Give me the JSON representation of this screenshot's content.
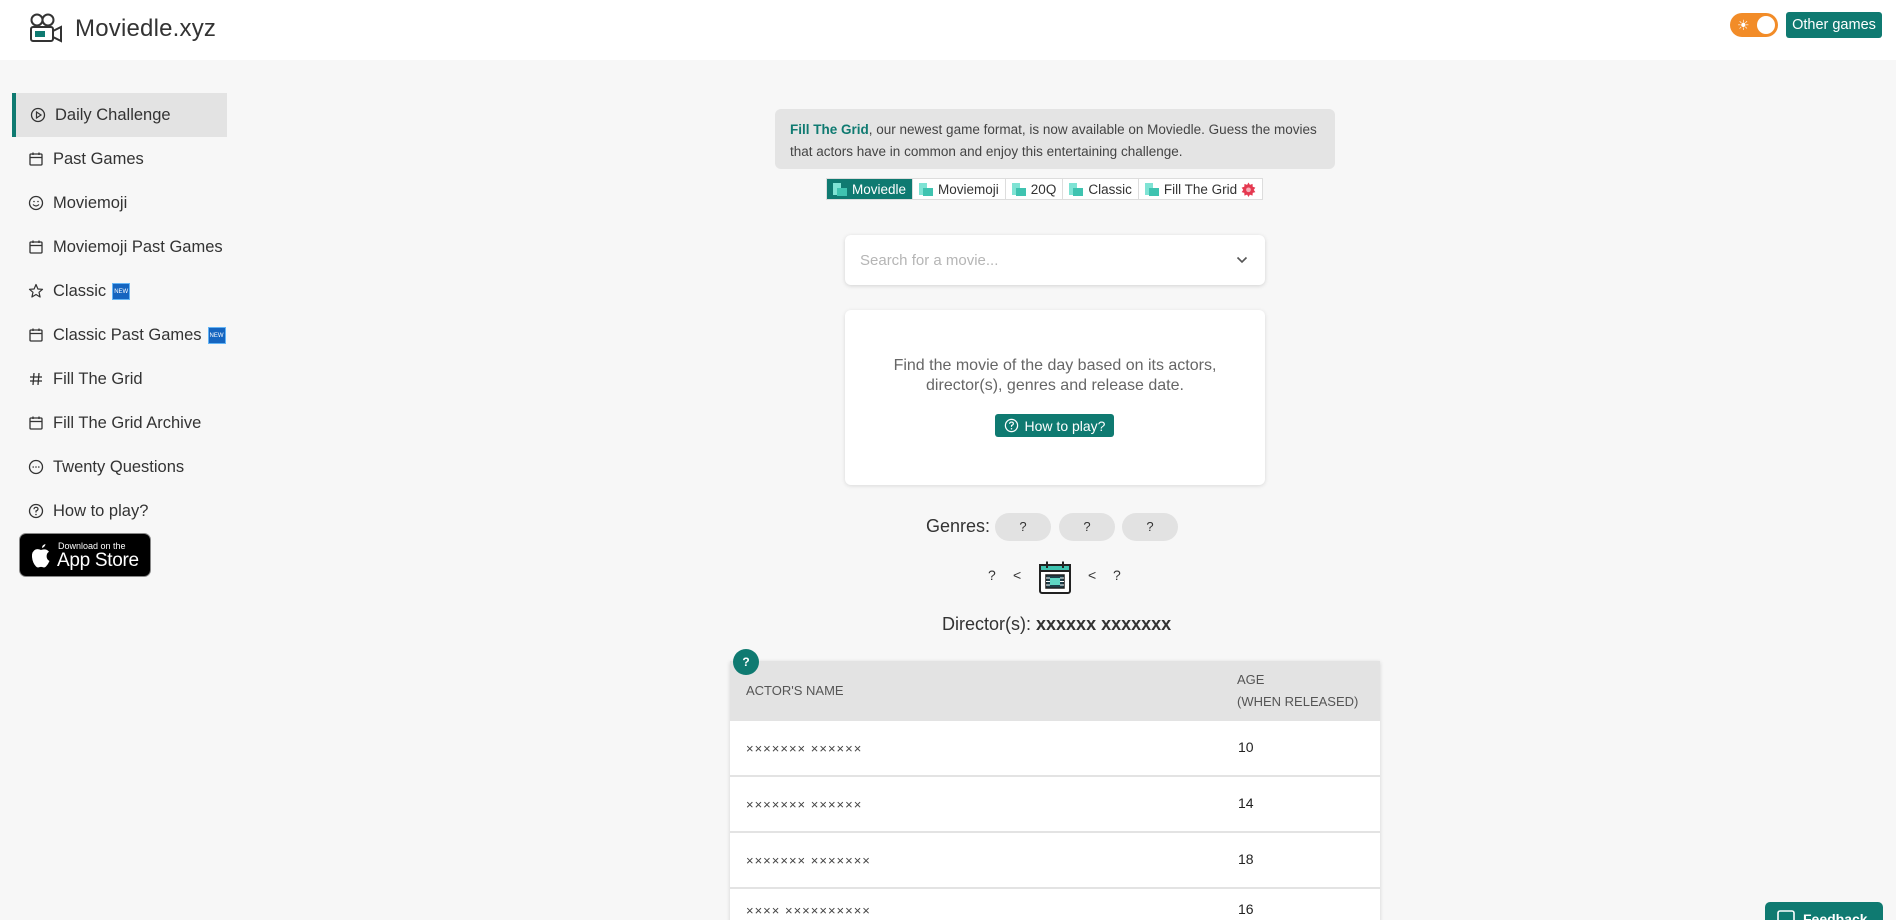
{
  "header": {
    "brand": "Moviedle.xyz",
    "other_games": "Other games"
  },
  "sidebar": {
    "items": [
      {
        "label": "Daily Challenge",
        "icon": "play-circle-icon",
        "active": true,
        "new": false
      },
      {
        "label": "Past Games",
        "icon": "calendar-icon",
        "new": false
      },
      {
        "label": "Moviemoji",
        "icon": "smiley-icon",
        "new": false
      },
      {
        "label": "Moviemoji Past Games",
        "icon": "calendar-icon",
        "new": false
      },
      {
        "label": "Classic",
        "icon": "star-icon",
        "new": true
      },
      {
        "label": "Classic Past Games",
        "icon": "calendar-icon",
        "new": true
      },
      {
        "label": "Fill The Grid",
        "icon": "hash-icon",
        "new": false
      },
      {
        "label": "Fill The Grid Archive",
        "icon": "calendar-icon",
        "new": false
      },
      {
        "label": "Twenty Questions",
        "icon": "chat-icon",
        "new": false
      },
      {
        "label": "How to play?",
        "icon": "help-circle-icon",
        "new": false
      }
    ],
    "new_badge": "NEW",
    "appstore_small": "Download on the",
    "appstore_big": "App Store"
  },
  "announcement": {
    "highlight": "Fill The Grid",
    "text": ", our newest game format, is now available on Moviedle. Guess the movies that actors have in common and enjoy this entertaining challenge."
  },
  "tabs": [
    "Moviedle",
    "Moviemoji",
    "20Q",
    "Classic",
    "Fill The Grid"
  ],
  "search": {
    "placeholder": "Search for a movie..."
  },
  "info": {
    "text": "Find the movie of the day based on its actors, director(s), genres and release date.",
    "button": "How to play?"
  },
  "genres": {
    "label": "Genres:",
    "values": [
      "?",
      "?",
      "?"
    ]
  },
  "year": {
    "min": "?",
    "lt1": "<",
    "lt2": "<",
    "max": "?"
  },
  "director": {
    "label": "Director(s):",
    "value": "xxxxxx xxxxxxx"
  },
  "table": {
    "help": "?",
    "col_name": "ACTOR'S NAME",
    "col_age": "AGE",
    "col_age_sub": "(WHEN RELEASED)",
    "rows": [
      {
        "name": "××××××× ××××××",
        "age": "10"
      },
      {
        "name": "××××××× ××××××",
        "age": "14"
      },
      {
        "name": "××××××× ×××××××",
        "age": "18"
      },
      {
        "name": "×××× ××××××××××",
        "age": "16"
      }
    ]
  },
  "feedback": "Feedback",
  "colors": {
    "accent": "#0f7a71",
    "toggle": "#f28c28"
  }
}
